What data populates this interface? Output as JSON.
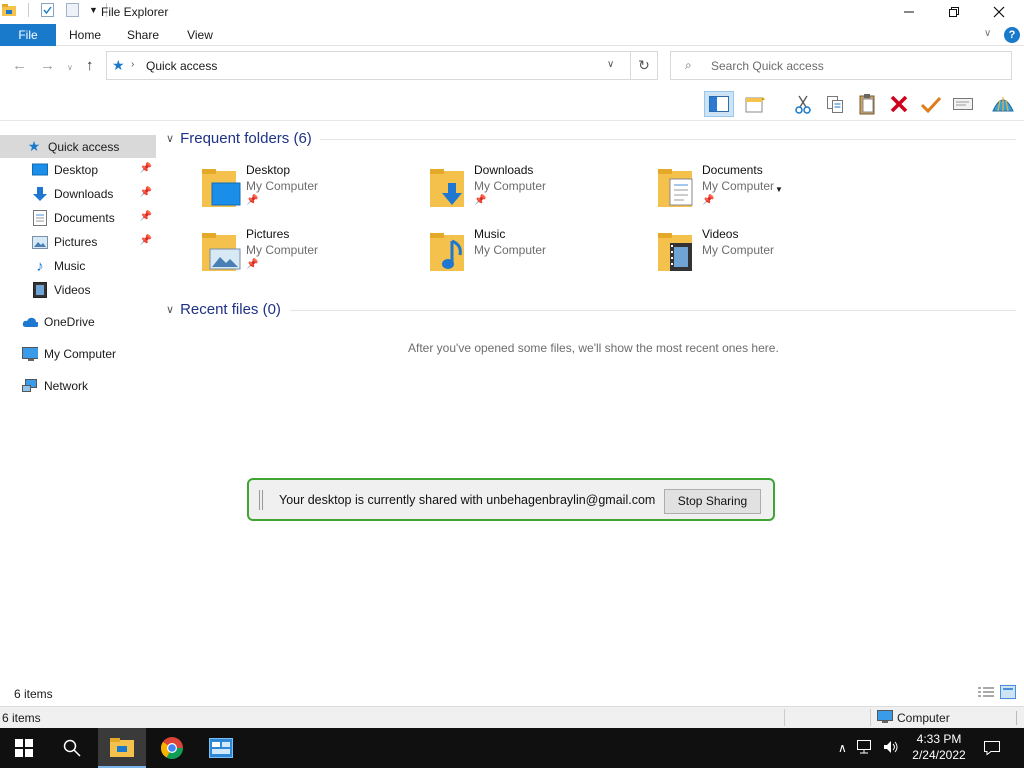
{
  "window": {
    "title": "File Explorer"
  },
  "ribbon": {
    "tabs": [
      "File",
      "Home",
      "Share",
      "View"
    ]
  },
  "address": {
    "path": "Quick access",
    "search_placeholder": "Search Quick access"
  },
  "nav": {
    "items": [
      {
        "label": "Quick access",
        "icon": "star-icon",
        "selected": true
      },
      {
        "label": "Desktop",
        "icon": "desktop-icon",
        "pinned": true
      },
      {
        "label": "Downloads",
        "icon": "download-icon",
        "pinned": true
      },
      {
        "label": "Documents",
        "icon": "documents-icon",
        "pinned": true
      },
      {
        "label": "Pictures",
        "icon": "pictures-icon",
        "pinned": true
      },
      {
        "label": "Music",
        "icon": "music-icon"
      },
      {
        "label": "Videos",
        "icon": "videos-icon"
      },
      {
        "label": "OneDrive",
        "icon": "cloud-icon"
      },
      {
        "label": "My Computer",
        "icon": "computer-icon"
      },
      {
        "label": "Network",
        "icon": "network-icon"
      }
    ]
  },
  "content": {
    "frequent_header": "Frequent folders (6)",
    "recent_header": "Recent files (0)",
    "empty_message": "After you've opened some files, we'll show the most recent ones here.",
    "folders": [
      {
        "name": "Desktop",
        "location": "My Computer",
        "pinned": true
      },
      {
        "name": "Downloads",
        "location": "My Computer",
        "pinned": true
      },
      {
        "name": "Documents",
        "location": "My Computer",
        "pinned": true
      },
      {
        "name": "Pictures",
        "location": "My Computer",
        "pinned": true
      },
      {
        "name": "Music",
        "location": "My Computer",
        "pinned": false
      },
      {
        "name": "Videos",
        "location": "My Computer",
        "pinned": false
      }
    ]
  },
  "share_banner": {
    "message": "Your desktop is currently shared with unbehagenbraylin@gmail.com",
    "button": "Stop Sharing"
  },
  "status": {
    "item_count": "6 items",
    "item_count_bottom": "6 items",
    "location": "Computer"
  },
  "taskbar": {
    "time": "4:33 PM",
    "date": "2/24/2022"
  },
  "colors": {
    "accent": "#1979ca",
    "share_border": "#3fa535",
    "taskbar": "#101010"
  }
}
